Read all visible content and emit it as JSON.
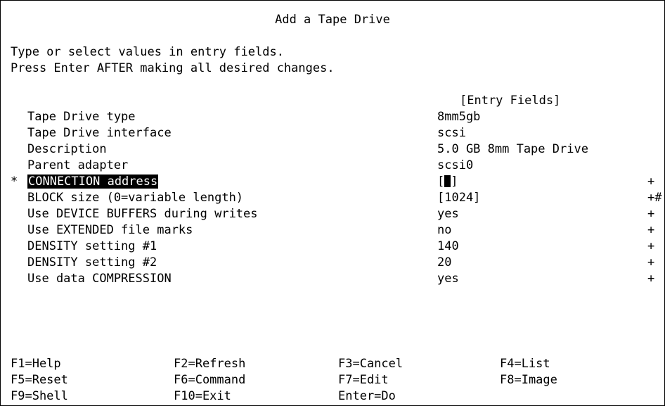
{
  "title": "Add a Tape Drive",
  "instructions": [
    "Type or select values in entry fields.",
    "Press Enter AFTER making all desired changes."
  ],
  "column_header": "[Entry Fields]",
  "fields": [
    {
      "required": "",
      "label": "Tape Drive type",
      "value": "8mm5gb",
      "flag": ""
    },
    {
      "required": "",
      "label": "Tape Drive interface",
      "value": "scsi",
      "flag": ""
    },
    {
      "required": "",
      "label": "Description",
      "value": "5.0 GB 8mm Tape Drive",
      "flag": ""
    },
    {
      "required": "",
      "label": "Parent adapter",
      "value": "scsi0",
      "flag": ""
    },
    {
      "required": "*",
      "label": "CONNECTION address",
      "value": "[",
      "value_suffix": "]",
      "flag": "+"
    },
    {
      "required": "",
      "label": "BLOCK size (0=variable length)",
      "value": "[1024]",
      "flag": "+#"
    },
    {
      "required": "",
      "label": "Use DEVICE BUFFERS during writes",
      "value": "yes",
      "flag": "+"
    },
    {
      "required": "",
      "label": "Use EXTENDED file marks",
      "value": "no",
      "flag": "+"
    },
    {
      "required": "",
      "label": "DENSITY setting #1",
      "value": "140",
      "flag": "+"
    },
    {
      "required": "",
      "label": "DENSITY setting #2",
      "value": "20",
      "flag": "+"
    },
    {
      "required": "",
      "label": "Use data COMPRESSION",
      "value": "yes",
      "flag": "+"
    }
  ],
  "function_keys": [
    [
      "F1=Help",
      "F2=Refresh",
      "F3=Cancel",
      "F4=List"
    ],
    [
      "F5=Reset",
      "F6=Command",
      "F7=Edit",
      "F8=Image"
    ],
    [
      "F9=Shell",
      "F10=Exit",
      "Enter=Do"
    ]
  ]
}
